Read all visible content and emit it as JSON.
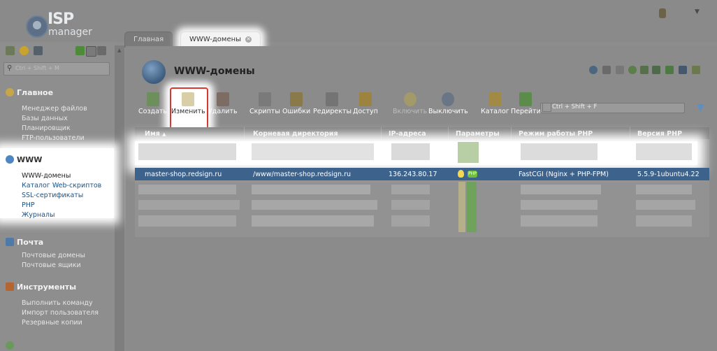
{
  "logo": {
    "brand": "ISP",
    "product": "manager"
  },
  "tabs": [
    {
      "label": "Главная"
    },
    {
      "label": "WWW-домены"
    }
  ],
  "sidebar": {
    "search_placeholder": "Ctrl + Shift + M",
    "sections": [
      {
        "title": "Главное",
        "items": [
          "Менеджер файлов",
          "Базы данных",
          "Планировщик",
          "FTP-пользователи"
        ]
      },
      {
        "title": "WWW",
        "items": [
          "WWW-домены",
          "Каталог Web-скриптов",
          "SSL-сертификаты",
          "PHP",
          "Журналы"
        ]
      },
      {
        "title": "Почта",
        "items": [
          "Почтовые домены",
          "Почтовые ящики"
        ]
      },
      {
        "title": "Инструменты",
        "items": [
          "Выполнить команду",
          "Импорт пользователя",
          "Резервные копии"
        ]
      }
    ]
  },
  "main": {
    "title": "WWW-домены",
    "toolbar": [
      {
        "label": "Создать"
      },
      {
        "label": "Изменить"
      },
      {
        "label": "Удалить"
      },
      {
        "label": "Скрипты"
      },
      {
        "label": "Ошибки"
      },
      {
        "label": "Редиректы"
      },
      {
        "label": "Доступ"
      },
      {
        "label": "Включить"
      },
      {
        "label": "Выключить"
      },
      {
        "label": "Каталог"
      },
      {
        "label": "Перейти"
      }
    ],
    "filter_placeholder": "Ctrl + Shift + F",
    "columns": [
      "Имя",
      "Корневая директория",
      "IP-адреса",
      "Параметры",
      "Режим работы PHP",
      "Версия PHP"
    ],
    "sort_indicator": "▲",
    "selected_row": {
      "name": "master-shop.redsign.ru",
      "root": "/www/master-shop.redsign.ru",
      "ip": "136.243.80.17",
      "php_badge": "PHP",
      "php_mode": "FastCGI (Nginx + PHP-FPM)",
      "php_version": "5.5.9-1ubuntu4.22"
    }
  },
  "colors": {
    "selected_row": "#3d628c",
    "highlight_border": "#d9372e",
    "link_blue": "#16528a",
    "page_gray": "#8d8d8d"
  }
}
